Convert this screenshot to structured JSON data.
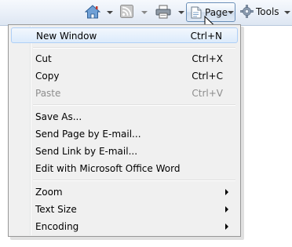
{
  "toolbar": {
    "home_icon": "home-icon",
    "feeds_icon": "rss-feeds-icon",
    "print_icon": "printer-icon",
    "page_label": "Page",
    "tools_label": "Tools",
    "page_icon": "page-icon",
    "tools_icon": "gear-icon"
  },
  "menu": {
    "items": [
      {
        "label": "New Window",
        "shortcut": "Ctrl+N",
        "state": "highlighted"
      },
      {
        "label": "Cut",
        "shortcut": "Ctrl+X",
        "state": "enabled"
      },
      {
        "label": "Copy",
        "shortcut": "Ctrl+C",
        "state": "enabled"
      },
      {
        "label": "Paste",
        "shortcut": "Ctrl+V",
        "state": "disabled"
      },
      {
        "label": "Save As...",
        "shortcut": "",
        "state": "enabled"
      },
      {
        "label": "Send Page by E-mail...",
        "shortcut": "",
        "state": "enabled"
      },
      {
        "label": "Send Link by E-mail...",
        "shortcut": "",
        "state": "enabled"
      },
      {
        "label": "Edit with Microsoft Office Word",
        "shortcut": "",
        "state": "enabled"
      },
      {
        "label": "Zoom",
        "shortcut": "",
        "state": "submenu"
      },
      {
        "label": "Text Size",
        "shortcut": "",
        "state": "submenu"
      },
      {
        "label": "Encoding",
        "shortcut": "",
        "state": "submenu"
      }
    ]
  },
  "colors": {
    "highlight_border": "#aecff7",
    "menu_background": "#f0f0f0",
    "disabled_text": "#8d8d8d"
  }
}
